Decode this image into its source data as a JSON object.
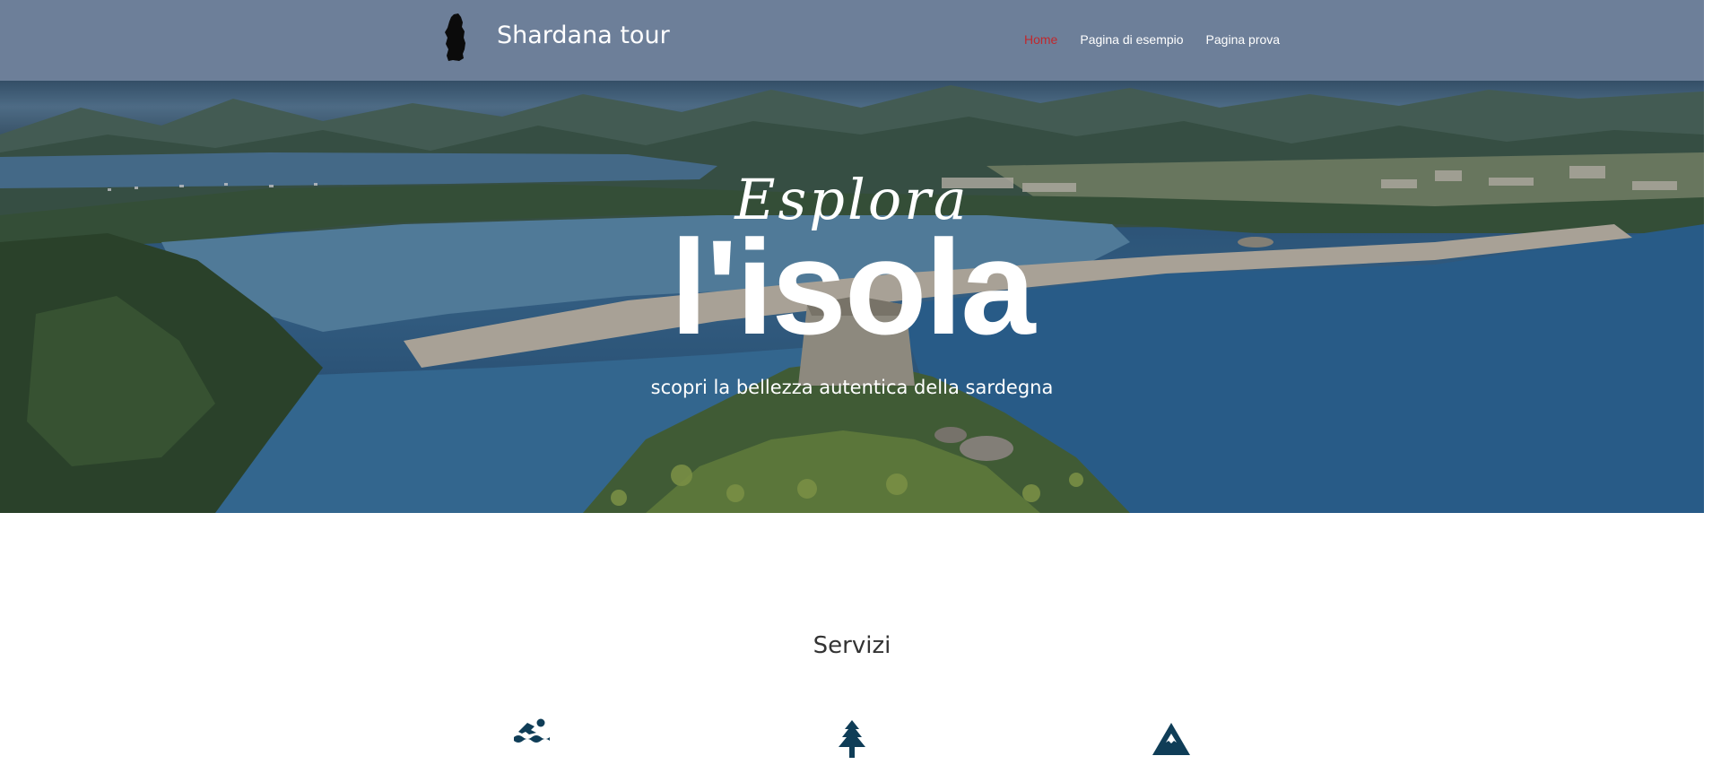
{
  "site": {
    "title": "Shardana tour"
  },
  "nav": {
    "items": [
      {
        "label": "Home",
        "active": true
      },
      {
        "label": "Pagina di esempio",
        "active": false
      },
      {
        "label": "Pagina prova",
        "active": false
      }
    ]
  },
  "hero": {
    "kicker": "Esplora",
    "title": "l'isola",
    "subtitle": "scopri la bellezza autentica della sardegna"
  },
  "services": {
    "title": "Servizi",
    "icons": [
      "swimmer-icon",
      "tree-icon",
      "mountain-icon"
    ]
  },
  "colors": {
    "header_bg": "#6d7f99",
    "nav_active": "#c0282d",
    "icon_color": "#0f3d57"
  }
}
